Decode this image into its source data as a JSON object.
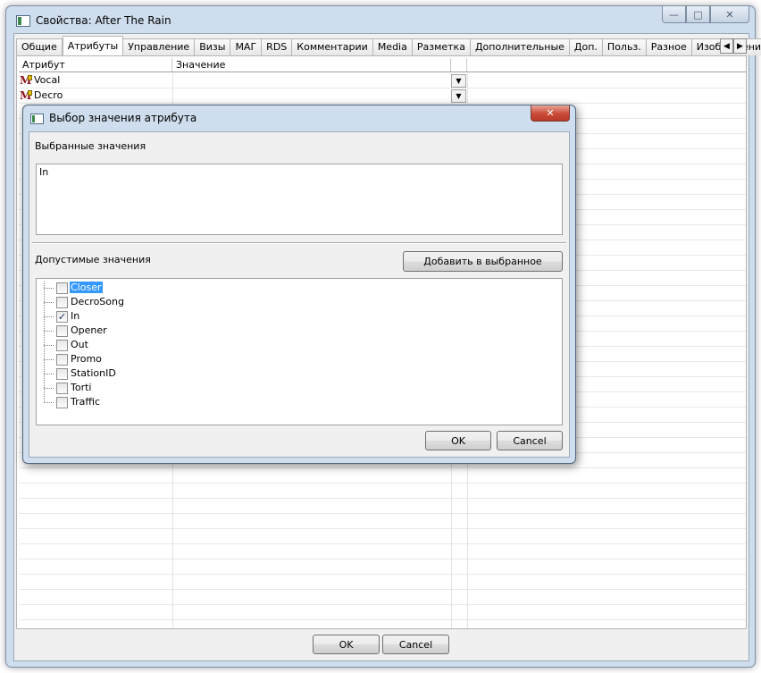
{
  "window": {
    "title": "Свойства: After The Rain",
    "min_glyph": "—",
    "max_glyph": "□",
    "close_glyph": "✕"
  },
  "tabs": [
    "Общие",
    "Атрибуты",
    "Управление",
    "Визы",
    "МАГ",
    "RDS",
    "Комментарии",
    "Media",
    "Разметка",
    "Дополнительные",
    "Доп.",
    "Польз.",
    "Разное",
    "Изображени"
  ],
  "active_tab": "Атрибуты",
  "tab_arrows": {
    "left": "◀",
    "right": "▶"
  },
  "grid": {
    "columns": [
      "Атрибут",
      "Значение"
    ],
    "rows": [
      {
        "icon": "M",
        "name": "Vocal",
        "dropdown": "▼"
      },
      {
        "icon": "M",
        "name": "Decro",
        "dropdown": "▼"
      }
    ]
  },
  "main_buttons": {
    "ok": "OK",
    "cancel": "Cancel"
  },
  "dialog": {
    "title": "Выбор значения атрибута",
    "close_glyph": "✕",
    "selected_label": "Выбранные значения",
    "selected_value": "In",
    "allowed_label": "Допустимые значения",
    "add_button": "Добавить в выбранное",
    "items": [
      {
        "label": "Closer",
        "checked": false,
        "selected": true
      },
      {
        "label": "DecroSong",
        "checked": false,
        "selected": false
      },
      {
        "label": "In",
        "checked": true,
        "selected": false
      },
      {
        "label": "Opener",
        "checked": false,
        "selected": false
      },
      {
        "label": "Out",
        "checked": false,
        "selected": false
      },
      {
        "label": "Promo",
        "checked": false,
        "selected": false
      },
      {
        "label": "StationID",
        "checked": false,
        "selected": false
      },
      {
        "label": "Torti",
        "checked": false,
        "selected": false
      },
      {
        "label": "Traffic",
        "checked": false,
        "selected": false
      }
    ],
    "ok": "OK",
    "cancel": "Cancel"
  }
}
